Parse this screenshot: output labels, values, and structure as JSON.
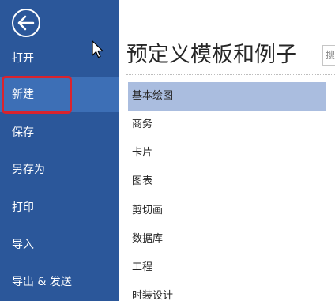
{
  "colors": {
    "sidebar_bg": "#2b579a",
    "sidebar_selected_bg": "#3d6fb6",
    "highlight_border": "#d9232d",
    "list_selected_bg": "#aabddf"
  },
  "sidebar": {
    "back_icon": "back-arrow-icon",
    "items": [
      {
        "label": "打开",
        "selected": false
      },
      {
        "label": "新建",
        "selected": true
      },
      {
        "label": "保存",
        "selected": false
      },
      {
        "label": "另存为",
        "selected": false
      },
      {
        "label": "打印",
        "selected": false
      },
      {
        "label": "导入",
        "selected": false
      },
      {
        "label": "导出 & 发送",
        "selected": false
      }
    ]
  },
  "main": {
    "title": "预定义模板和例子",
    "search_text": "搜",
    "categories": [
      {
        "label": "基本绘图",
        "selected": true
      },
      {
        "label": "商务",
        "selected": false
      },
      {
        "label": "卡片",
        "selected": false
      },
      {
        "label": "图表",
        "selected": false
      },
      {
        "label": "剪切画",
        "selected": false
      },
      {
        "label": "数据库",
        "selected": false
      },
      {
        "label": "工程",
        "selected": false
      },
      {
        "label": "时装设计",
        "selected": false
      }
    ]
  }
}
